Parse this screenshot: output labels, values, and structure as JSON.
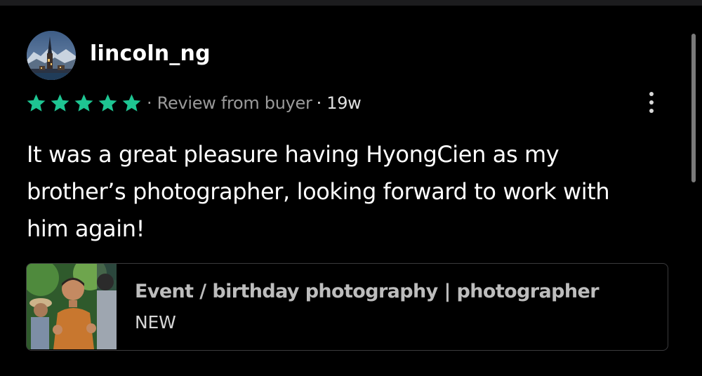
{
  "review": {
    "username": "lincoln_ng",
    "rating": 5,
    "rating_max": 5,
    "source_label": "· Review from buyer",
    "time_label": "· 19w",
    "text": "It was a great pleasure having HyongCien as my brother’s photographer, looking forward to work with him again!"
  },
  "listing": {
    "title": "Event / birthday photography | photographer",
    "status": "NEW"
  },
  "colors": {
    "background": "#000000",
    "star": "#1ec592",
    "meta_text": "#9a9a9a",
    "card_border": "#3a3a3c"
  },
  "icons": {
    "more": "vertical-ellipsis-icon",
    "star": "star-icon"
  }
}
